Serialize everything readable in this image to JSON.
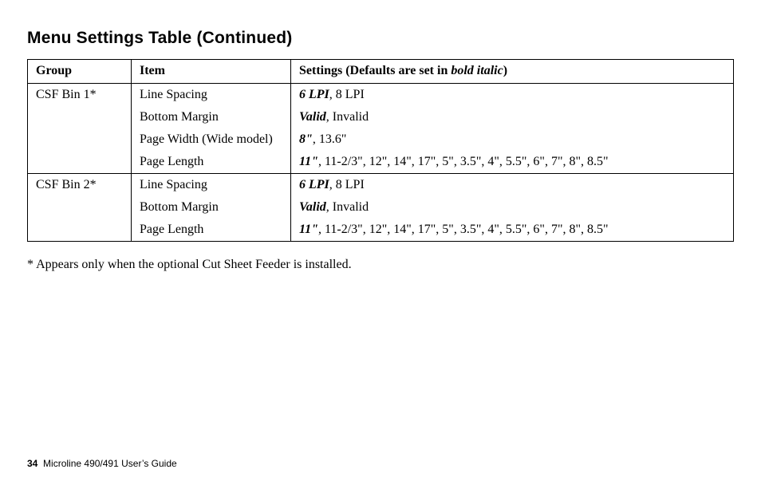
{
  "title": "Menu Settings Table (Continued)",
  "headers": {
    "group": "Group",
    "item": "Item",
    "settings_prefix": "Settings (Defaults are set in ",
    "settings_bi": "bold italic",
    "settings_suffix": ")"
  },
  "groups": [
    {
      "name": "CSF Bin 1*",
      "rows": [
        {
          "item": "Line Spacing",
          "default": "6 LPI",
          "rest": ", 8 LPI"
        },
        {
          "item": "Bottom Margin",
          "default": "Valid",
          "rest": ", Invalid"
        },
        {
          "item": "Page Width (Wide model)",
          "default": "8\"",
          "rest": ", 13.6\""
        },
        {
          "item": "Page Length",
          "default": "11\"",
          "rest": ", 11-2/3\", 12\", 14\", 17\", 5\", 3.5\", 4\", 5.5\", 6\", 7\", 8\", 8.5\""
        }
      ]
    },
    {
      "name": "CSF Bin 2*",
      "rows": [
        {
          "item": "Line Spacing",
          "default": "6 LPI",
          "rest": ", 8 LPI"
        },
        {
          "item": "Bottom Margin",
          "default": "Valid",
          "rest": ", Invalid"
        },
        {
          "item": "Page Length",
          "default": "11\"",
          "rest": ", 11-2/3\", 12\", 14\", 17\", 5\", 3.5\", 4\", 5.5\", 6\", 7\", 8\", 8.5\""
        }
      ]
    }
  ],
  "footnote": "* Appears only when the optional Cut Sheet Feeder is installed.",
  "footer": {
    "page": "34",
    "book": "Microline 490/491 User’s Guide"
  }
}
